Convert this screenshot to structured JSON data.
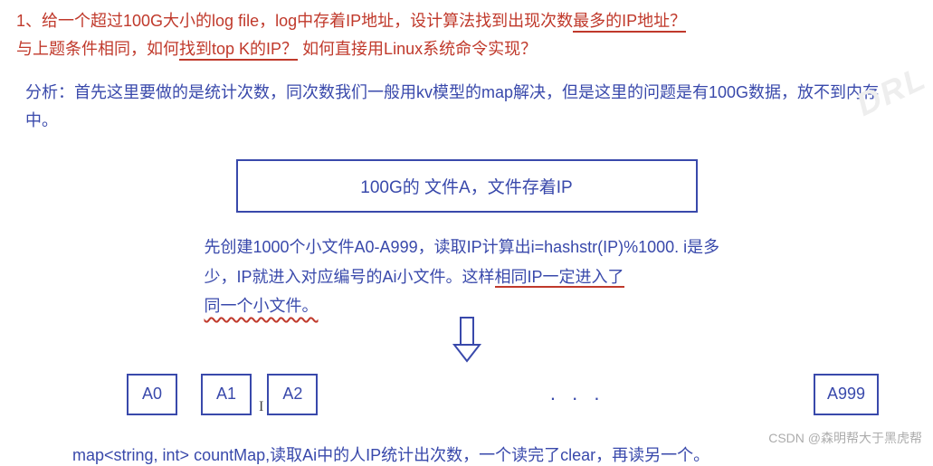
{
  "question": {
    "line1_prefix": "1、给一个超过100G大小的log file，log中存着IP地址，设计算法找到出现次数",
    "line1_underlined": "最多的IP地址？",
    "line2_prefix": "与上题条件相同，如何",
    "line2_underlined": "找到top K的IP？",
    "line2_suffix": "如何直接用Linux系统命令实现？"
  },
  "analysis": "分析：首先这里要做的是统计次数，同次数我们一般用kv模型的map解决，但是这里的问题是有100G数据，放不到内存中。",
  "main_box": "100G的 文件A，文件存着IP",
  "step": {
    "part1": "先创建1000个小文件A0-A999，读取IP计算出i=hashstr(IP)%1000. i是多少，IP就进入对应编号的Ai小文件。这样",
    "underlined1": "相同IP一定进入了",
    "underlined2": "同一个小文件。"
  },
  "small_files": {
    "f0": "A0",
    "f1": "A1",
    "f2": "A2",
    "dots": ". . .",
    "flast": "A999"
  },
  "footer": "map<string, int> countMap,读取Ai中的人IP统计出次数，一个读完了clear，再读另一个。",
  "watermark": "CSDN @森明帮大于黑虎帮",
  "wm2": "DRL"
}
